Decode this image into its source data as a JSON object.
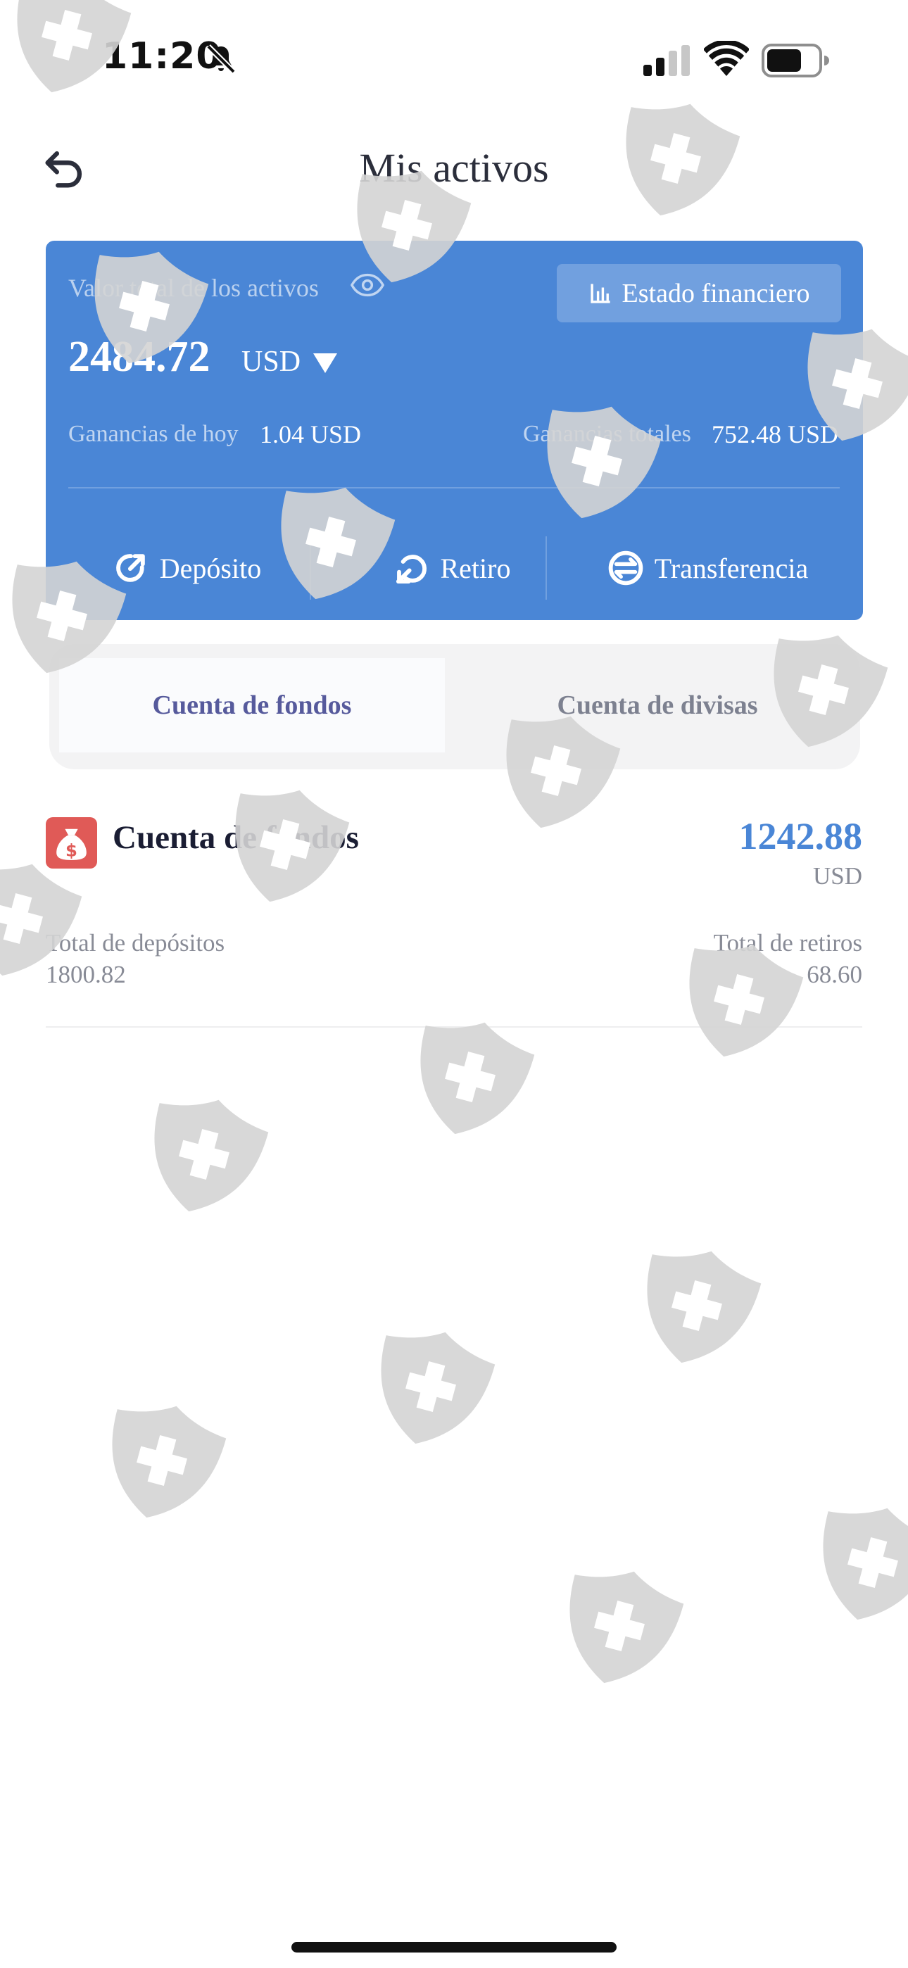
{
  "status_bar": {
    "time": "11:20"
  },
  "header": {
    "title": "Mis activos"
  },
  "assets": {
    "total_label": "Valor total de los activos",
    "total_value": "2484.72",
    "currency": "USD",
    "statement_button": "Estado financiero",
    "today_label": "Ganancias de hoy",
    "today_value": "1.04 USD",
    "overall_label": "Ganancias totales",
    "overall_value": "752.48 USD",
    "actions": [
      {
        "label": "Depósito",
        "icon": "deposit-icon"
      },
      {
        "label": "Retiro",
        "icon": "withdraw-icon"
      },
      {
        "label": "Transferencia",
        "icon": "transfer-icon"
      }
    ]
  },
  "tabs": [
    {
      "label": "Cuenta de fondos",
      "active": true
    },
    {
      "label": "Cuenta de divisas",
      "active": false
    }
  ],
  "fund_account": {
    "title": "Cuenta de fondos",
    "amount": "1242.88",
    "currency": "USD",
    "deposits_label": "Total de depósitos",
    "deposits_value": "1800.82",
    "withdrawals_label": "Total de retiros",
    "withdrawals_value": "68.60"
  },
  "colors": {
    "card_blue": "#4a86d6",
    "fund_icon_red": "#e05a57",
    "active_tab_text": "#565a9c",
    "amount_blue": "#4a86d6",
    "watermark_gray": "#d4d4d4"
  }
}
